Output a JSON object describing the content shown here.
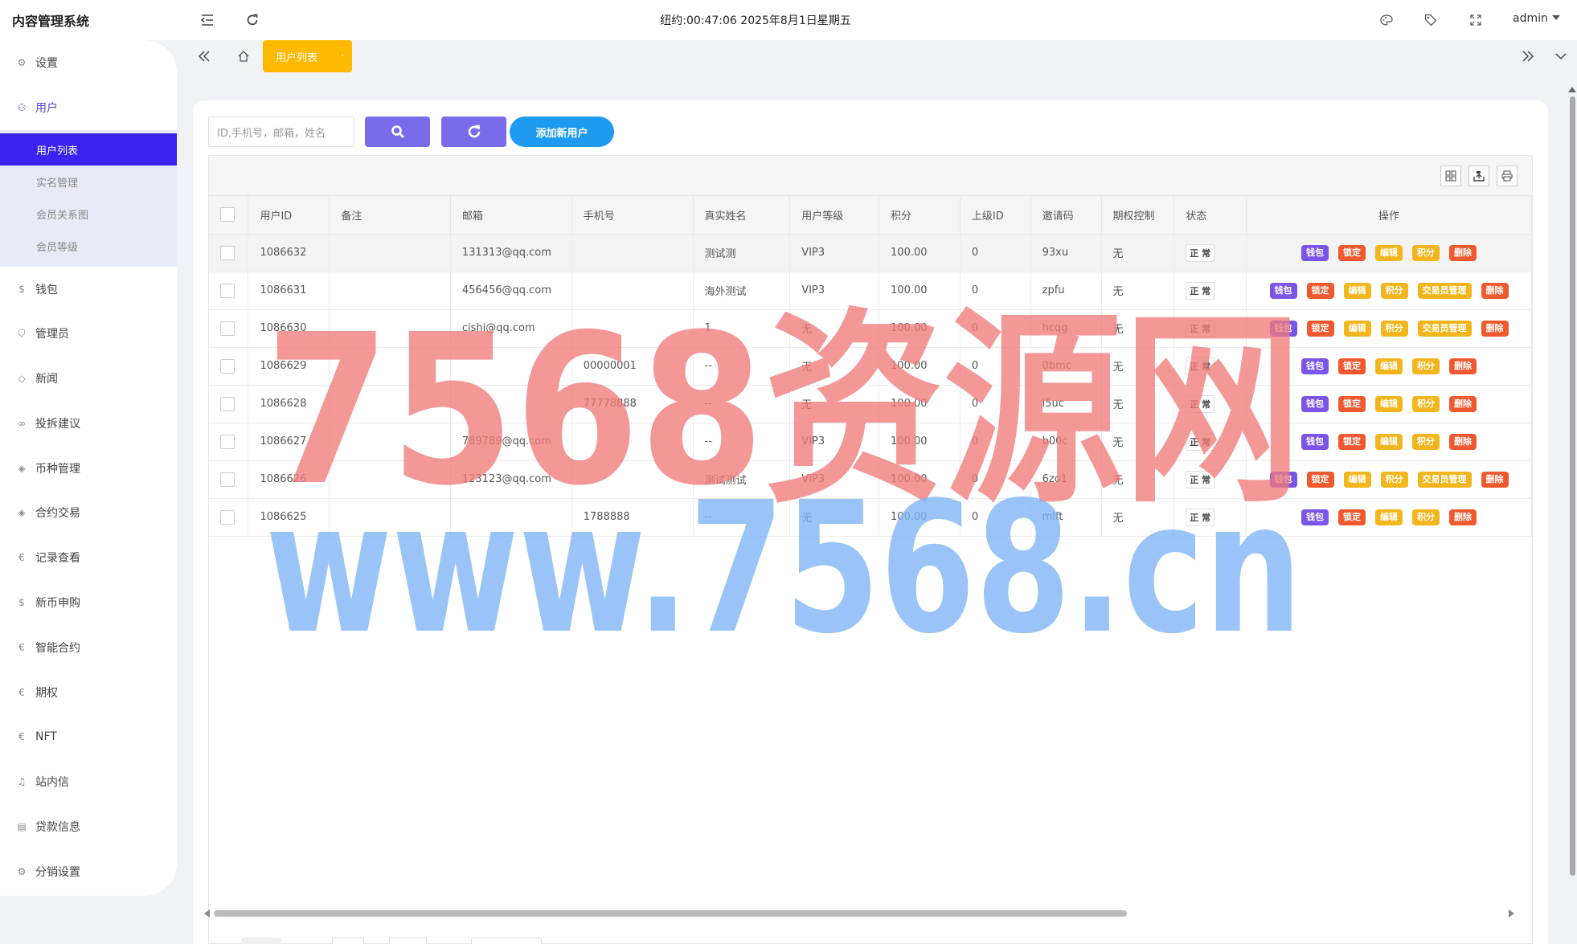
{
  "app": {
    "title": "内容管理系统",
    "clock": "纽约:00:47:06 2025年8月1日星期五",
    "user": "admin"
  },
  "sidebar": {
    "items": [
      {
        "label": "设置",
        "icon": "gear-icon"
      },
      {
        "label": "用户",
        "icon": "user-icon",
        "active": true
      },
      {
        "label": "钱包",
        "icon": "dollar-icon"
      },
      {
        "label": "管理员",
        "icon": "shield-icon"
      },
      {
        "label": "新闻",
        "icon": "tag-icon"
      },
      {
        "label": "投拆建议",
        "icon": "link-icon"
      },
      {
        "label": "币种管理",
        "icon": "diamond-icon"
      },
      {
        "label": "合约交易",
        "icon": "diamond-icon"
      },
      {
        "label": "记录查看",
        "icon": "euro-icon"
      },
      {
        "label": "新币申购",
        "icon": "dollar-icon"
      },
      {
        "label": "智能合约",
        "icon": "euro-icon"
      },
      {
        "label": "期权",
        "icon": "euro-icon"
      },
      {
        "label": "NFT",
        "icon": "euro-icon"
      },
      {
        "label": "站内信",
        "icon": "bell-icon"
      },
      {
        "label": "贷款信息",
        "icon": "document-icon"
      },
      {
        "label": "分销设置",
        "icon": "gear-icon"
      }
    ],
    "sub_items": [
      {
        "label": "用户列表",
        "active": true
      },
      {
        "label": "实名管理"
      },
      {
        "label": "会员关系图"
      },
      {
        "label": "会员等级"
      }
    ]
  },
  "tabs": {
    "active_label": "用户列表"
  },
  "toolbar": {
    "search_placeholder": "ID,手机号，邮箱，姓名",
    "add_label": "添加新用户"
  },
  "table": {
    "columns": [
      "用户ID",
      "备注",
      "邮箱",
      "手机号",
      "真实姓名",
      "用户等级",
      "积分",
      "上级ID",
      "邀请码",
      "期权控制",
      "状态",
      "操作"
    ],
    "rows": [
      {
        "id": "1086632",
        "note": "",
        "email": "131313@qq.com",
        "phone": "",
        "name": "测试测",
        "level": "VIP3",
        "points": "100.00",
        "parent": "0",
        "code": "93xu",
        "option": "无",
        "status": "正 常",
        "trader": false
      },
      {
        "id": "1086631",
        "note": "",
        "email": "456456@qq.com",
        "phone": "",
        "name": "海外测试",
        "level": "VIP3",
        "points": "100.00",
        "parent": "0",
        "code": "zpfu",
        "option": "无",
        "status": "正 常",
        "trader": true
      },
      {
        "id": "1086630",
        "note": "",
        "email": "cishi@qq.com",
        "phone": "",
        "name": "1",
        "level": "无",
        "points": "100.00",
        "parent": "0",
        "code": "hcqg",
        "option": "无",
        "status": "正 常",
        "trader": true
      },
      {
        "id": "1086629",
        "note": "",
        "email": "",
        "phone": "00000001",
        "name": "--",
        "level": "无",
        "points": "100.00",
        "parent": "0",
        "code": "0bmc",
        "option": "无",
        "status": "正 常",
        "trader": false
      },
      {
        "id": "1086628",
        "note": "",
        "email": "",
        "phone": "77778888",
        "name": "--",
        "level": "无",
        "points": "100.00",
        "parent": "0",
        "code": "l5uc",
        "option": "无",
        "status": "正 常",
        "trader": false
      },
      {
        "id": "1086627",
        "note": "",
        "email": "789789@qq.com",
        "phone": "",
        "name": "--",
        "level": "VIP3",
        "points": "100.00",
        "parent": "0",
        "code": "b00c",
        "option": "无",
        "status": "正 常",
        "trader": false
      },
      {
        "id": "1086626",
        "note": "",
        "email": "123123@qq.com",
        "phone": "",
        "name": "测试测试",
        "level": "VIP3",
        "points": "100.00",
        "parent": "0",
        "code": "6zo1",
        "option": "无",
        "status": "正 常",
        "trader": true
      },
      {
        "id": "1086625",
        "note": "",
        "email": "",
        "phone": "1788888",
        "name": "--",
        "level": "无",
        "points": "100.00",
        "parent": "0",
        "code": "mlft",
        "option": "无",
        "status": "正 常",
        "trader": false
      }
    ],
    "ops": {
      "wallet": "钱包",
      "lock": "锁定",
      "edit": "编辑",
      "points": "积分",
      "trader": "交易员管理",
      "delete": "删除"
    }
  },
  "watermark": {
    "line1": "7568资源网",
    "line2": "www.7568.cn",
    "color1": "#f07a7a",
    "color2": "#7db4f5"
  }
}
